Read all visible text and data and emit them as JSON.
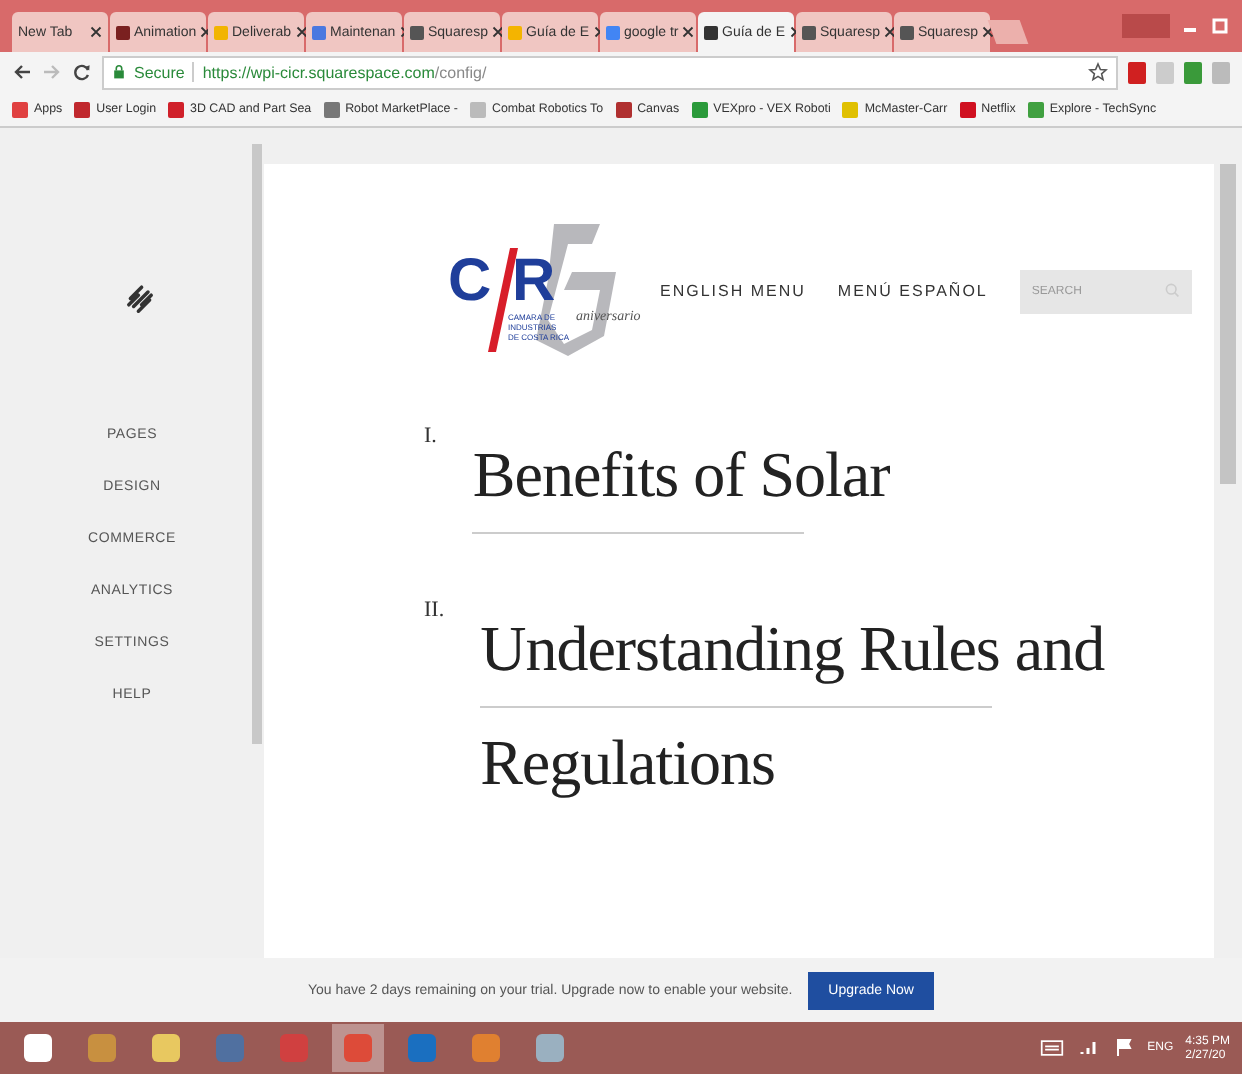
{
  "tabs": [
    {
      "label": "New Tab",
      "selected": false
    },
    {
      "label": "Animation",
      "selected": false
    },
    {
      "label": "Deliverab",
      "selected": false
    },
    {
      "label": "Maintenan",
      "selected": false
    },
    {
      "label": "Squaresp",
      "selected": false
    },
    {
      "label": "Guía de E",
      "selected": false
    },
    {
      "label": "google tr",
      "selected": false
    },
    {
      "label": "Guía de E",
      "selected": true
    },
    {
      "label": "Squaresp",
      "selected": false
    },
    {
      "label": "Squaresp",
      "selected": false
    }
  ],
  "address": {
    "secure": "Secure",
    "url_host": "https://wpi-cicr.squarespace.com",
    "url_path": "/config/"
  },
  "bookmarks": [
    {
      "label": "Apps",
      "color": "#e04040"
    },
    {
      "label": "User Login",
      "color": "#c0282d"
    },
    {
      "label": "3D CAD and Part Sea",
      "color": "#d0202a"
    },
    {
      "label": "Robot MarketPlace -",
      "color": "#777777"
    },
    {
      "label": "Combat Robotics To",
      "color": "#bbbbbb"
    },
    {
      "label": "Canvas",
      "color": "#b03030"
    },
    {
      "label": "VEXpro - VEX Roboti",
      "color": "#2a9a3a"
    },
    {
      "label": "McMaster-Carr",
      "color": "#e0c000"
    },
    {
      "label": "Netflix",
      "color": "#d01020"
    },
    {
      "label": "Explore - TechSync",
      "color": "#40a040"
    }
  ],
  "sidebar": {
    "items": [
      "PAGES",
      "DESIGN",
      "COMMERCE",
      "ANALYTICS",
      "SETTINGS",
      "HELP"
    ]
  },
  "site": {
    "logo": {
      "c": "C",
      "r": "R",
      "script": "aniversario",
      "org": [
        "CAMARA DE",
        "INDUSTRIAS",
        "DE COSTA RICA"
      ]
    },
    "nav": [
      "ENGLISH MENU",
      "MENÚ ESPAÑOL"
    ],
    "search": {
      "placeholder": "SEARCH"
    },
    "sections": [
      {
        "numeral": "I.",
        "lines": [
          "Benefits of Solar"
        ]
      },
      {
        "numeral": "II.",
        "lines": [
          "Understanding Rules and",
          "Regulations"
        ]
      }
    ]
  },
  "trial": {
    "message": "You have 2 days remaining on your trial. Upgrade now to enable your website.",
    "button": "Upgrade Now"
  },
  "taskbar": {
    "apps": [
      {
        "kind": "windows",
        "active": false
      },
      {
        "kind": "media",
        "active": false
      },
      {
        "kind": "folder",
        "active": false
      },
      {
        "kind": "orb",
        "active": false
      },
      {
        "kind": "tool",
        "active": false
      },
      {
        "kind": "chrome",
        "active": true
      },
      {
        "kind": "outlook",
        "active": false
      },
      {
        "kind": "paint",
        "active": false
      },
      {
        "kind": "calc",
        "active": false
      }
    ],
    "lang": "ENG",
    "time": "4:35 PM",
    "date": "2/27/20"
  }
}
